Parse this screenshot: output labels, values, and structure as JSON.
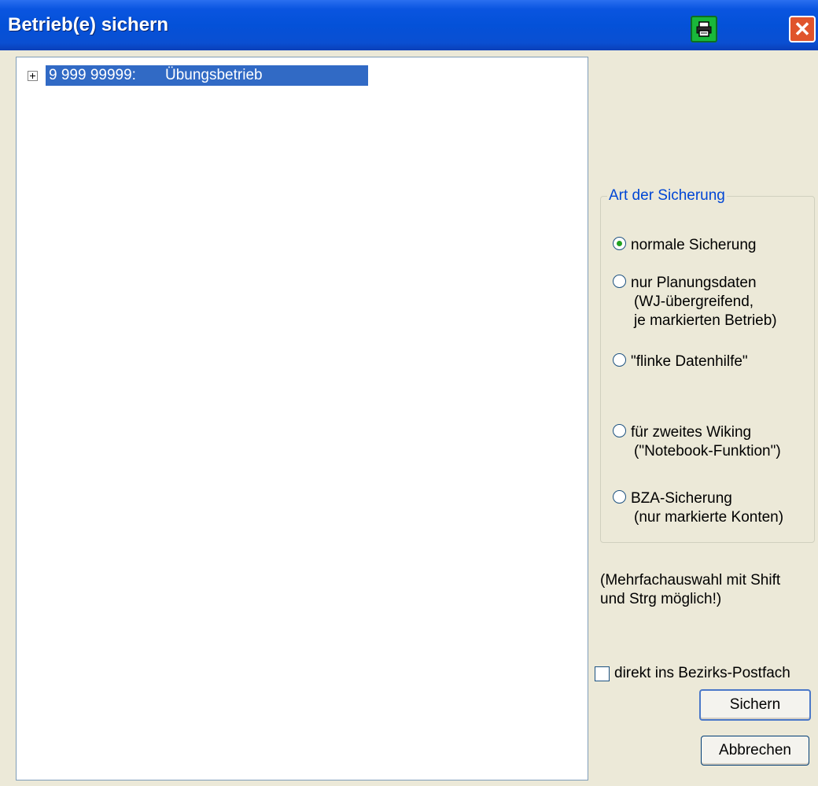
{
  "window": {
    "title": "Betrieb(e) sichern",
    "print_icon": "printer-icon",
    "close_icon": "close-icon",
    "close_glyph": "✕"
  },
  "tree": {
    "items": [
      {
        "number": "9 999 99999:",
        "name": "Übungsbetrieb",
        "selected": true,
        "expander": "plus"
      }
    ],
    "selection_color": "#316ac5"
  },
  "backup_type": {
    "legend": "Art der Sicherung",
    "options": [
      {
        "lines": [
          "normale Sicherung"
        ],
        "selected": true
      },
      {
        "lines": [
          "nur Planungsdaten",
          "(WJ-übergreifend,",
          "je markierten Betrieb)"
        ],
        "selected": false
      },
      {
        "lines": [
          "\"flinke Datenhilfe\""
        ],
        "selected": false
      },
      {
        "lines": [
          "für zweites Wiking",
          "(\"Notebook-Funktion\")"
        ],
        "selected": false
      },
      {
        "lines": [
          "BZA-Sicherung",
          "(nur markierte Konten)"
        ],
        "selected": false
      }
    ]
  },
  "note": {
    "line1": "(Mehrfachauswahl mit Shift",
    "line2": "und Strg möglich!)"
  },
  "postfach_checkbox": {
    "label": "direkt ins Bezirks-Postfach",
    "checked": false
  },
  "buttons": {
    "save": "Sichern",
    "cancel": "Abbrechen"
  },
  "colors": {
    "titlebar": "#0451d8",
    "legend": "#0046d5",
    "background": "#ece9d8"
  }
}
